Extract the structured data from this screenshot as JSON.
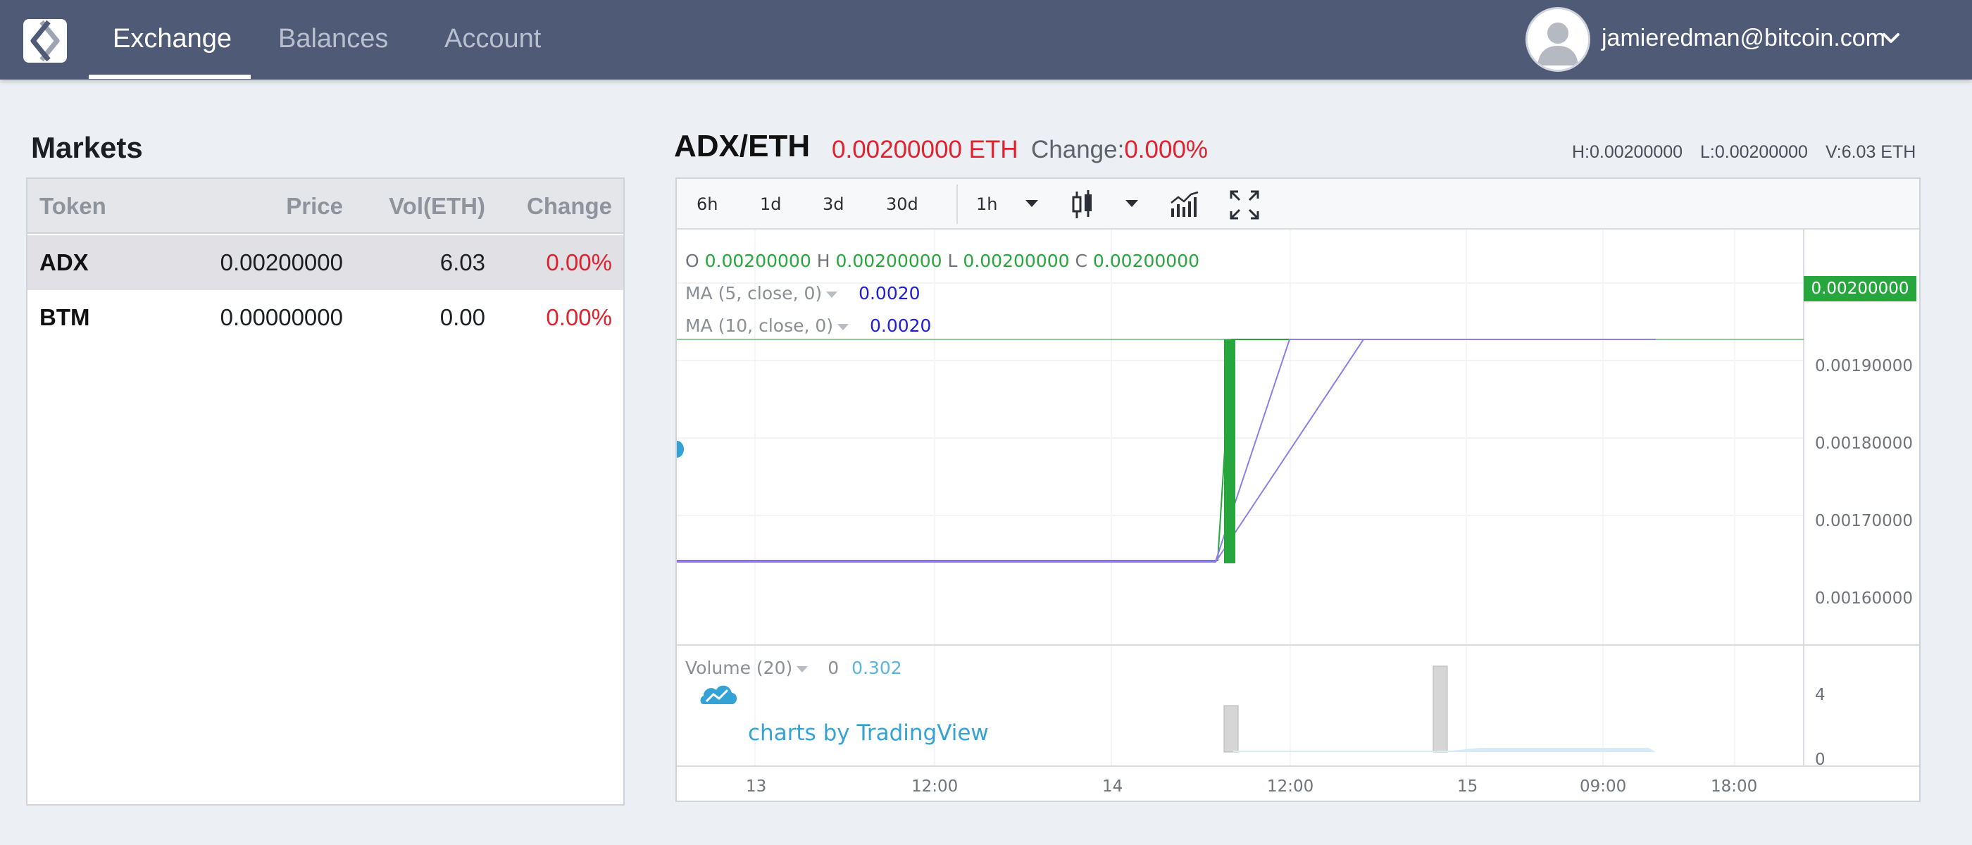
{
  "nav": {
    "tabs": [
      {
        "label": "Exchange",
        "active": true
      },
      {
        "label": "Balances",
        "active": false
      },
      {
        "label": "Account",
        "active": false
      }
    ],
    "user_email": "jamieredman@bitcoin.com"
  },
  "markets": {
    "title": "Markets",
    "columns": [
      "Token",
      "Price",
      "Vol(ETH)",
      "Change"
    ],
    "rows": [
      {
        "token": "ADX",
        "price": "0.00200000",
        "vol": "6.03",
        "change": "0.00%",
        "selected": true
      },
      {
        "token": "BTM",
        "price": "0.00000000",
        "vol": "0.00",
        "change": "0.00%",
        "selected": false
      }
    ]
  },
  "chart_header": {
    "pair": "ADX/ETH",
    "price": "0.00200000 ETH",
    "change_label": "Change:",
    "change_value": "0.000%",
    "high": "H:0.00200000",
    "low": "L:0.00200000",
    "volume": "V:6.03 ETH"
  },
  "toolbar": {
    "ranges": [
      "6h",
      "1d",
      "3d",
      "30d"
    ],
    "interval": "1h",
    "icons": [
      "dropdown-caret-icon",
      "candlestick-icon",
      "dropdown-caret-icon",
      "indicators-icon",
      "fullscreen-icon"
    ]
  },
  "legend": {
    "ohlc": {
      "o_key": "O",
      "o": "0.00200000",
      "h_key": "H",
      "h": "0.00200000",
      "l_key": "L",
      "l": "0.00200000",
      "c_key": "C",
      "c": "0.00200000"
    },
    "ma5_label": "MA (5, close, 0)",
    "ma5_value": "0.0020",
    "ma10_label": "MA (10, close, 0)",
    "ma10_value": "0.0020",
    "volume_label": "Volume (20)",
    "volume_v1": "0",
    "volume_v2": "0.302"
  },
  "price_tag": "0.00200000",
  "branding": "charts by TradingView",
  "colors": {
    "up": "#26a63d",
    "down": "#e0222f",
    "ma": "#8c7ee6",
    "nav_bg": "#4f5a76"
  },
  "chart_data": {
    "type": "line",
    "title": "ADX/ETH",
    "x_ticks": [
      "13",
      "12:00",
      "14",
      "12:00",
      "15",
      "09:00",
      "18:00"
    ],
    "y_ticks": [
      "0.00190000",
      "0.00180000",
      "0.00170000",
      "0.00160000"
    ],
    "ylim": [
      0.00155,
      0.0021
    ],
    "current_price": 0.002,
    "series": [
      {
        "name": "MA (5, close, 0)",
        "values": [
          0.00156,
          0.00156,
          0.002,
          0.002
        ]
      },
      {
        "name": "MA (10, close, 0)",
        "values": [
          0.00156,
          0.00156,
          0.002,
          0.002
        ]
      }
    ],
    "volume_ticks": [
      "4",
      "0"
    ],
    "volume_ylim": [
      0,
      5.5
    ]
  }
}
